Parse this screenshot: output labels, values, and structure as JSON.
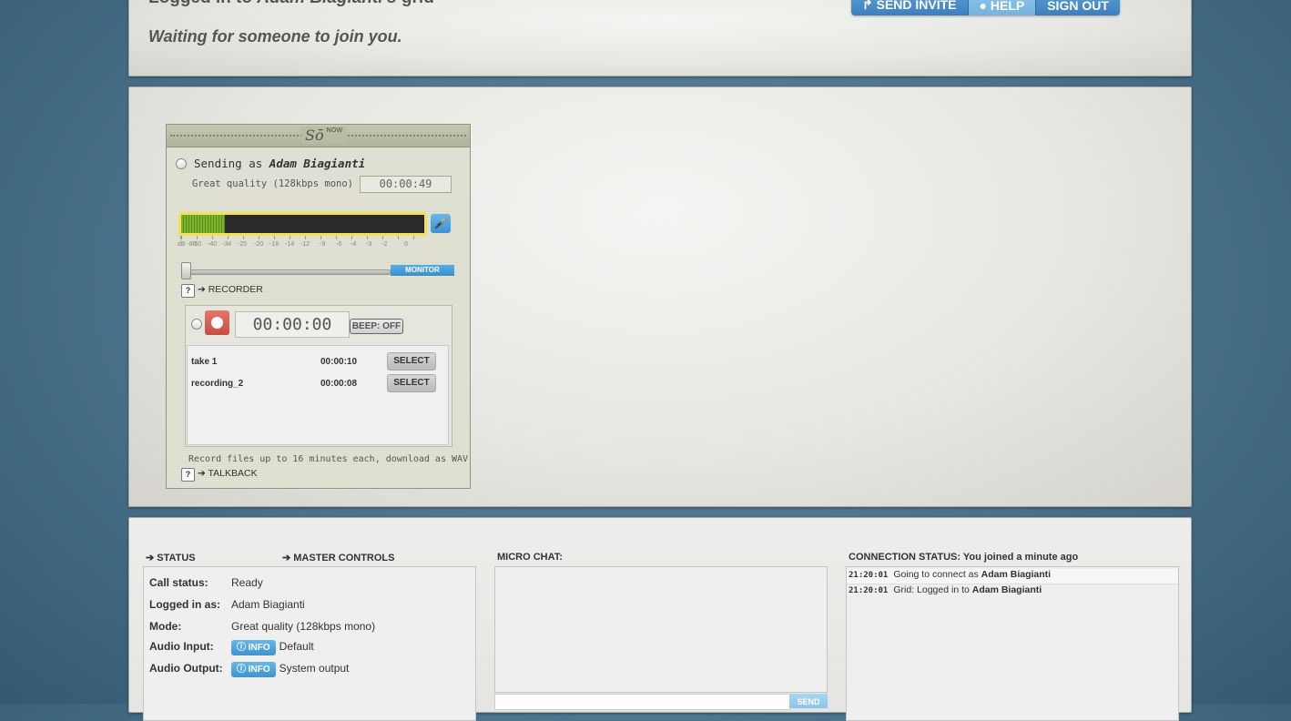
{
  "header": {
    "logged_prefix": "Logged in to ",
    "grid_owner": "Adam Biagianti's",
    "logged_suffix": " grid",
    "waiting": "Waiting for someone to join you.",
    "buttons": [
      {
        "label": "↱ SEND INVITE"
      },
      {
        "label": "● HELP"
      },
      {
        "label": "SIGN OUT"
      }
    ]
  },
  "widget": {
    "logo": "Sō",
    "logo_small": "NOW",
    "sending_prefix": "Sending as ",
    "sender": "Adam Biagianti",
    "quality": "Great quality (128kbps mono)",
    "elapsed": "00:00:49",
    "meter_level": 0.18,
    "scale": [
      "dB -80",
      "-50",
      "-40",
      "-34",
      "-25",
      "-20",
      "-18",
      "-14",
      "-12",
      "-9",
      "-6",
      "-4",
      "-3",
      "-2",
      "0"
    ],
    "monitor_label": "MONITOR",
    "recorder_toggle": "➔ RECORDER",
    "rec_timer": "00:00:00",
    "beep_label": "BEEP: OFF",
    "recordings": [
      {
        "name": "take 1",
        "duration": "00:00:10",
        "action": "SELECT"
      },
      {
        "name": "recording_2",
        "duration": "00:00:08",
        "action": "SELECT"
      }
    ],
    "rec_info": "Record files up to 16 minutes each, download as WAV",
    "talkback_toggle": "➔ TALKBACK"
  },
  "status": {
    "status_toggle": "➔ STATUS",
    "master_toggle": "➔ MASTER CONTROLS",
    "rows": [
      {
        "label": "Call status:",
        "value": "Ready"
      },
      {
        "label": "Logged in as:",
        "value": "Adam Biagianti"
      },
      {
        "label": "Mode:",
        "value": "Great quality (128kbps mono)"
      },
      {
        "label": "Audio Input:",
        "info": "INFO",
        "value": "Default"
      },
      {
        "label": "Audio Output:",
        "info": "INFO",
        "value": "System output"
      }
    ]
  },
  "chat": {
    "title": "MICRO CHAT:",
    "send_label": "SEND"
  },
  "connection": {
    "title": "CONNECTION STATUS: You joined a minute ago",
    "entries": [
      {
        "time": "21:20:01",
        "text": "Going to connect as ",
        "name": "Adam Biagianti"
      },
      {
        "time": "21:20:01",
        "text": "Grid: Logged in to ",
        "name": "Adam Biagianti"
      }
    ]
  },
  "colors": {
    "accent_blue": "#3d7fbd",
    "record_red": "#c94d43",
    "meter_green": "#7ab22b"
  }
}
